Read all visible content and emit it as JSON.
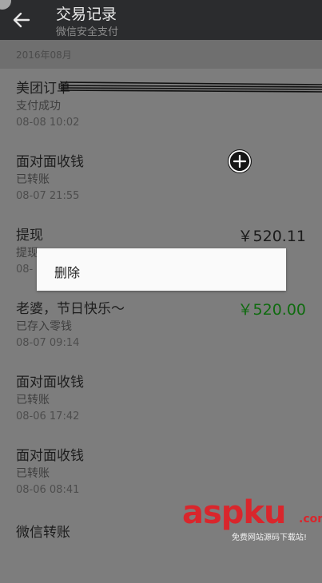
{
  "header": {
    "title": "交易记录",
    "subtitle": "微信安全支付"
  },
  "month": "2016年08月",
  "items": [
    {
      "name": "美团订单",
      "status": "支付成功",
      "time": "08-08 10:02",
      "amount": ""
    },
    {
      "name": "面对面收钱",
      "status": "已转账",
      "time": "08-07 21:55",
      "amount": ""
    },
    {
      "name": "提现",
      "status": "提现",
      "time": "08-",
      "amount": "￥520.11"
    },
    {
      "name": "老婆，节日快乐～",
      "status": "已存入零钱",
      "time": "08-07 09:14",
      "amount": "￥520.00"
    },
    {
      "name": "面对面收钱",
      "status": "已转账",
      "time": "08-06 17:42",
      "amount": ""
    },
    {
      "name": "面对面收钱",
      "status": "已转账",
      "time": "08-06 08:41",
      "amount": ""
    },
    {
      "name": "微信转账",
      "status": "",
      "time": "",
      "amount": ""
    }
  ],
  "popup": {
    "delete_label": "删除"
  },
  "icons": {
    "back": "back-arrow-icon",
    "plus": "plus-circle-icon"
  },
  "colors": {
    "header_bg": "#2b2c2e",
    "income_green": "#0f6b0f",
    "watermark_red": "#d9262c"
  },
  "watermark": {
    "main": "aspku",
    "com": ".com",
    "sub": "免费网站源码下载站!"
  }
}
